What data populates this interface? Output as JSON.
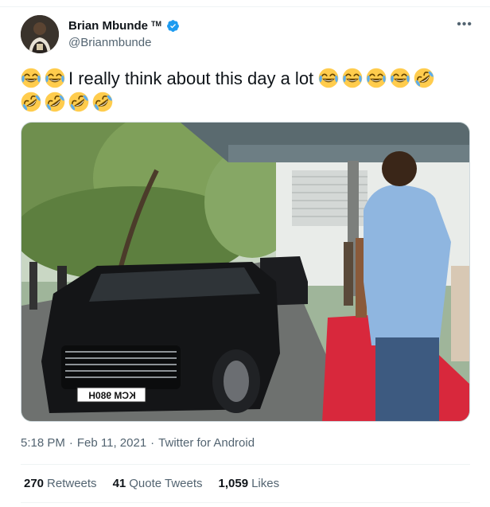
{
  "user": {
    "display_name": "Brian Mbunde",
    "tm": "TM",
    "handle": "@Brianmbunde",
    "verified": true
  },
  "tweet": {
    "text_before": "",
    "text": "I really think about this day a lot",
    "emojis_before": [
      "tears-of-joy",
      "tears-of-joy"
    ],
    "emojis_after_line1": [
      "tears-of-joy",
      "tears-of-joy",
      "tears-of-joy",
      "tears-of-joy",
      "rolling-laughing"
    ],
    "emojis_line2": [
      "rolling-laughing",
      "rolling-laughing",
      "rolling-laughing",
      "rolling-laughing"
    ]
  },
  "media": {
    "plate_text": "KCM 980H"
  },
  "meta": {
    "time": "5:18 PM",
    "sep1": "·",
    "date": "Feb 11, 2021",
    "sep2": "·",
    "source": "Twitter for Android"
  },
  "stats": {
    "retweets_count": "270",
    "retweets_label": "Retweets",
    "quotes_count": "41",
    "quotes_label": "Quote Tweets",
    "likes_count": "1,059",
    "likes_label": "Likes"
  },
  "colors": {
    "verified_blue": "#1d9bf0",
    "secondary_text": "#536471",
    "divider": "#eff3f4"
  }
}
